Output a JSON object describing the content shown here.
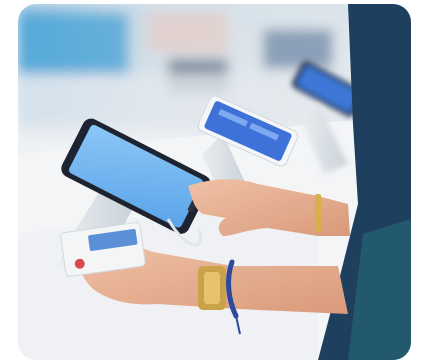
{
  "image": {
    "subject": "",
    "colors": {
      "screen": "#6fb3f0",
      "shirt": "#1f3f5e",
      "counter": "#f1f3f5",
      "skin": "#e2a98a",
      "watch": "#c9a24a",
      "bracelet": "#2c4aa0"
    }
  }
}
